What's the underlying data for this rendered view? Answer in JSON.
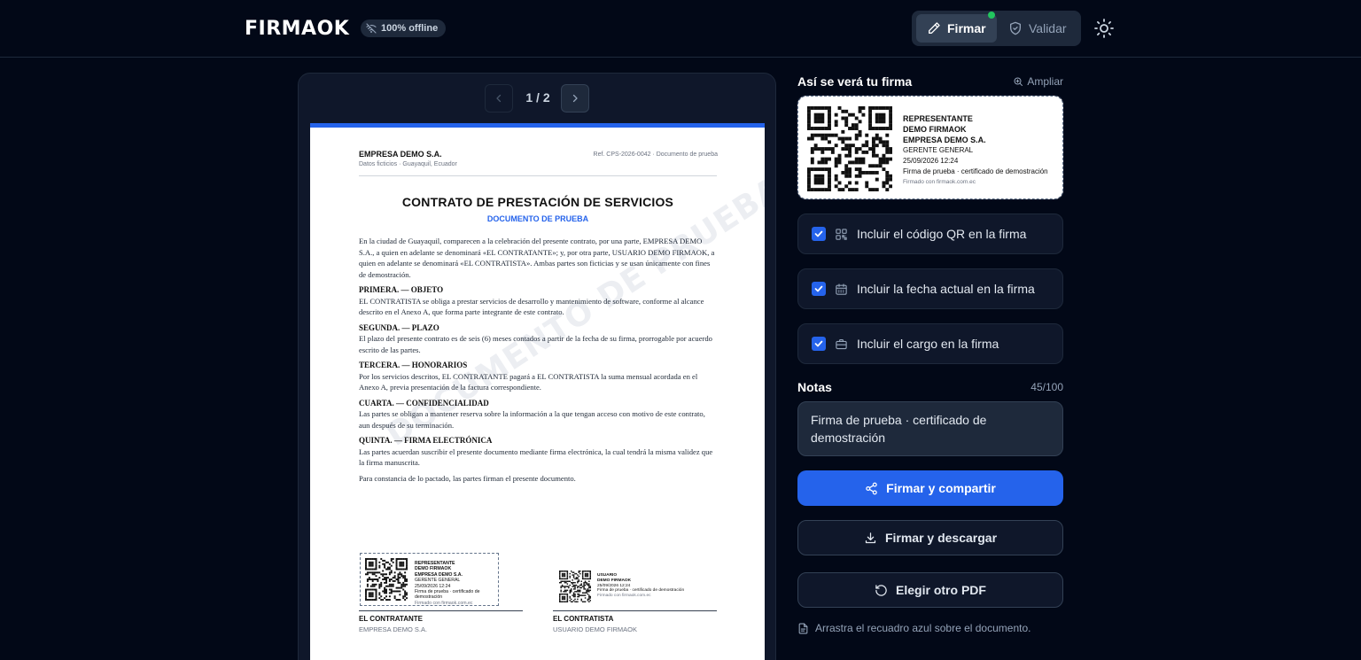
{
  "header": {
    "logo_text": "FIRMAOK",
    "offline_badge": "100% offline",
    "mode_sign": "Firmar",
    "mode_validate": "Validar"
  },
  "viewer": {
    "page_indicator": "1 / 2",
    "document": {
      "company": "EMPRESA DEMO S.A.",
      "company_sub": "Datos ficticios · Guayaquil, Ecuador",
      "ref": "Ref. CPS-2026-0042 · Documento de prueba",
      "title": "CONTRATO DE PRESTACIÓN DE SERVICIOS",
      "subtitle": "DOCUMENTO DE PRUEBA",
      "watermark": "DOCUMENTO DE PRUEBA",
      "intro": "En la ciudad de Guayaquil, comparecen a la celebración del presente contrato, por una parte, EMPRESA DEMO S.A., a quien en adelante se denominará «EL CONTRATANTE»; y, por otra parte, USUARIO DEMO FIRMAOK, a quien en adelante se denominará «EL CONTRATISTA». Ambas partes son ficticias y se usan únicamente con fines de demostración.",
      "clauses": [
        {
          "heading": "PRIMERA. — OBJETO",
          "text": "EL CONTRATISTA se obliga a prestar servicios de desarrollo y mantenimiento de software, conforme al alcance descrito en el Anexo A, que forma parte integrante de este contrato."
        },
        {
          "heading": "SEGUNDA. — PLAZO",
          "text": "El plazo del presente contrato es de seis (6) meses contados a partir de la fecha de su firma, prorrogable por acuerdo escrito de las partes."
        },
        {
          "heading": "TERCERA. — HONORARIOS",
          "text": "Por los servicios descritos, EL CONTRATANTE pagará a EL CONTRATISTA la suma mensual acordada en el Anexo A, previa presentación de la factura correspondiente."
        },
        {
          "heading": "CUARTA. — CONFIDENCIALIDAD",
          "text": "Las partes se obligan a mantener reserva sobre la información a la que tengan acceso con motivo de este contrato, aun después de su terminación."
        },
        {
          "heading": "QUINTA. — FIRMA ELECTRÓNICA",
          "text": "Las partes acuerdan suscribir el presente documento mediante firma electrónica, la cual tendrá la misma validez que la firma manuscrita."
        }
      ],
      "closing": "Para constancia de lo pactado, las partes firman el presente documento.",
      "signer_a": {
        "role": "EL CONTRATANTE",
        "name": "EMPRESA DEMO S.A.",
        "stamp": [
          "REPRESENTANTE",
          "DEMO FIRMAOK",
          "EMPRESA DEMO S.A.",
          "GERENTE GENERAL",
          "25/09/2026 12:24",
          "Firma de prueba · certificado de demostración",
          "Firmado con firmaok.com.ec"
        ]
      },
      "signer_b": {
        "role": "EL CONTRATISTA",
        "name": "USUARIO DEMO FIRMAOK",
        "stamp": [
          "USUARIO",
          "DEMO FIRMAOK",
          "25/09/2026 12:24",
          "Firma de prueba · certificado de demostración",
          "Firmado con firmaok.com.ec"
        ]
      }
    }
  },
  "panel": {
    "preview_title": "Así se verá tu firma",
    "zoom_label": "Ampliar",
    "preview": {
      "line1": "REPRESENTANTE",
      "line2": "DEMO FIRMAOK",
      "line3": "EMPRESA DEMO S.A.",
      "line4": "GERENTE GENERAL",
      "line5": "25/09/2026 12:24",
      "line6": "Firma de prueba · certificado de demostración",
      "line7": "Firmado con firmaok.com.ec"
    },
    "options": [
      {
        "label": "Incluir el código QR en la firma",
        "checked": true,
        "icon": "qr-icon"
      },
      {
        "label": "Incluir la fecha actual en la firma",
        "checked": true,
        "icon": "calendar-icon"
      },
      {
        "label": "Incluir el cargo en la firma",
        "checked": true,
        "icon": "briefcase-icon"
      }
    ],
    "notes_label": "Notas",
    "notes_count": "45/100",
    "notes_value": "Firma de prueba · certificado de demostración",
    "btn_share": "Firmar y compartir",
    "btn_download": "Firmar y descargar",
    "btn_other": "Elegir otro PDF",
    "hint": "Arrastra el recuadro azul sobre el documento."
  },
  "colors": {
    "background": "#020817",
    "primary": "#2563eb",
    "status_dot": "#22c55e"
  }
}
